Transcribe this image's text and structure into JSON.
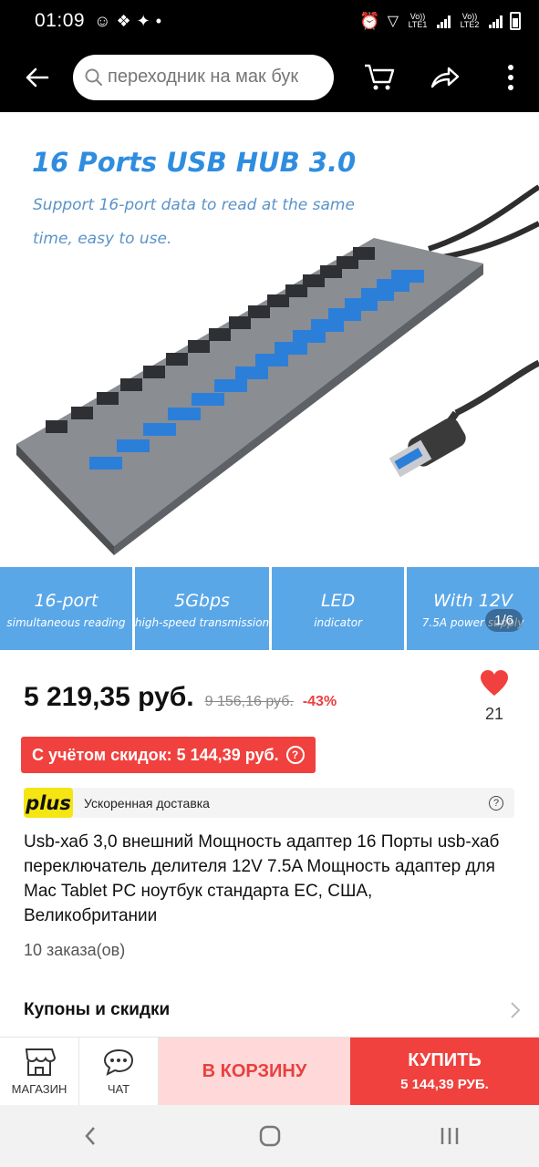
{
  "status": {
    "time": "01:09",
    "lte1": "Vo)) LTE1",
    "lte2": "Vo)) LTE2"
  },
  "search": {
    "placeholder": "переходник на мак бук"
  },
  "hero": {
    "title": "16 Ports USB HUB 3.0",
    "subtitle": "Support 16-port data to read at the same time, easy to use.",
    "features": [
      {
        "main": "16-port",
        "sub": "simultaneous reading"
      },
      {
        "main": "5Gbps",
        "sub": "high-speed transmission"
      },
      {
        "main": "LED",
        "sub": "indicator"
      },
      {
        "main": "With 12V",
        "sub": "7.5A power supply"
      }
    ],
    "pager": "1/6"
  },
  "price": {
    "current": "5 219,35 руб.",
    "old": "9 156,16 руб.",
    "discount": "-43%"
  },
  "favorite": {
    "count": "21"
  },
  "promo": {
    "text": "С учётом скидок: 5 144,39 руб.",
    "help": "?"
  },
  "delivery": {
    "logo": "plus",
    "text": "Ускоренная доставка",
    "help": "?"
  },
  "product": {
    "title": "Usb-хаб 3,0 внешний Мощность адаптер 16 Порты usb-хаб переключатель делителя 12V 7.5A Мощность адаптер для Mac Tablet PC ноутбук стандарта ЕС, США, Великобритании",
    "orders": "10 заказа(ов)"
  },
  "coupons": {
    "label": "Купоны и скидки"
  },
  "actions": {
    "store": "МАГАЗИН",
    "chat": "ЧАТ",
    "cart": "В КОРЗИНУ",
    "buy": "КУПИТЬ",
    "buy_price": "5 144,39 РУБ."
  },
  "colors": {
    "accent": "#f0413e",
    "cart_bg": "#ffd9d9",
    "feature_blue": "#5aa7e8",
    "title_blue": "#2f8de0",
    "plus_yellow": "#f5e512"
  }
}
